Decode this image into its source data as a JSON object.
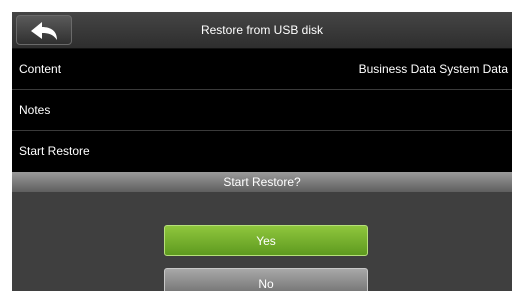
{
  "header": {
    "title": "Restore from USB disk",
    "back_icon": "back-arrow-icon"
  },
  "rows": [
    {
      "label": "Content",
      "value": "Business Data System Data"
    },
    {
      "label": "Notes",
      "value": ""
    },
    {
      "label": "Start Restore",
      "value": ""
    }
  ],
  "dialog": {
    "title": "Start Restore?",
    "yes_label": "Yes",
    "no_label": "No"
  },
  "colors": {
    "accent_green": "#7bb42f",
    "background": "#000000",
    "dialog_background": "#3f3f3f"
  }
}
